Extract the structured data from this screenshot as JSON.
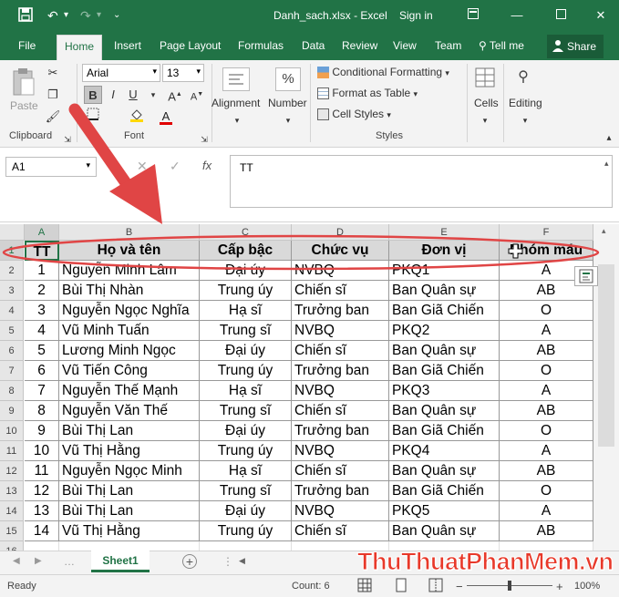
{
  "titlebar": {
    "filename": "Danh_sach.xlsx",
    "sep": "-",
    "app": "Excel",
    "signin": "Sign in",
    "save_icon": "save-icon",
    "undo_icon": "undo-icon",
    "redo_icon": "redo-icon"
  },
  "tabs": [
    "File",
    "Home",
    "Insert",
    "Page Layout",
    "Formulas",
    "Data",
    "Review",
    "View",
    "Team"
  ],
  "tellme": "Tell me",
  "share": "Share",
  "ribbon": {
    "clipboard": {
      "label": "Clipboard",
      "paste": "Paste"
    },
    "font": {
      "label": "Font",
      "name": "Arial",
      "size": "13",
      "bold": "B",
      "italic": "I",
      "underline": "U"
    },
    "alignment": "Alignment",
    "number": {
      "label": "Number",
      "symbol": "%"
    },
    "styles": {
      "label": "Styles",
      "conditional": "Conditional Formatting",
      "table": "Format as Table",
      "cell": "Cell Styles"
    },
    "cells": "Cells",
    "editing": "Editing"
  },
  "formula": {
    "namebox": "A1",
    "fx": "fx",
    "value": "TT"
  },
  "columns": [
    "A",
    "B",
    "C",
    "D",
    "E",
    "F"
  ],
  "header": [
    "TT",
    "Họ và tên",
    "Cấp bậc",
    "Chức vụ",
    "Đơn vị",
    "Nhóm máu"
  ],
  "rows": [
    [
      "1",
      "Nguyễn Minh Lâm",
      "Đại úy",
      "NVBQ",
      "PKQ1",
      "A"
    ],
    [
      "2",
      "Bùi Thị Nhàn",
      "Trung úy",
      "Chiến sĩ",
      "Ban Quân sự",
      "AB"
    ],
    [
      "3",
      "Nguyễn Ngọc Nghĩa",
      "Hạ sĩ",
      "Trưởng ban",
      "Ban Giã Chiến",
      "O"
    ],
    [
      "4",
      "Vũ Minh Tuấn",
      "Trung sĩ",
      "NVBQ",
      "PKQ2",
      "A"
    ],
    [
      "5",
      "Lương Minh Ngọc",
      "Đại úy",
      "Chiến sĩ",
      "Ban Quân sự",
      "AB"
    ],
    [
      "6",
      "Vũ Tiến Công",
      "Trung úy",
      "Trưởng ban",
      "Ban Giã Chiến",
      "O"
    ],
    [
      "7",
      "Nguyễn Thế Mạnh",
      "Hạ sĩ",
      "NVBQ",
      "PKQ3",
      "A"
    ],
    [
      "8",
      "Nguyễn Văn Thế",
      "Trung sĩ",
      "Chiến sĩ",
      "Ban Quân sự",
      "AB"
    ],
    [
      "9",
      "Bùi Thị Lan",
      "Đại úy",
      "Trưởng ban",
      "Ban Giã Chiến",
      "O"
    ],
    [
      "10",
      "Vũ Thị Hằng",
      "Trung úy",
      "NVBQ",
      "PKQ4",
      "A"
    ],
    [
      "11",
      "Nguyễn Ngọc Minh",
      "Hạ sĩ",
      "Chiến sĩ",
      "Ban Quân sự",
      "AB"
    ],
    [
      "12",
      "Bùi Thị Lan",
      "Trung sĩ",
      "Trưởng ban",
      "Ban Giã Chiến",
      "O"
    ],
    [
      "13",
      "Bùi Thị Lan",
      "Đại úy",
      "NVBQ",
      "PKQ5",
      "A"
    ],
    [
      "14",
      "Vũ Thị Hằng",
      "Trung úy",
      "Chiến sĩ",
      "Ban Quân sự",
      "AB"
    ]
  ],
  "row_numbers": [
    "1",
    "2",
    "3",
    "4",
    "5",
    "6",
    "7",
    "8",
    "9",
    "10",
    "11",
    "12",
    "13",
    "14",
    "15",
    "16"
  ],
  "sheet_tab": "Sheet1",
  "status": {
    "ready": "Ready",
    "count": "Count: 6",
    "zoom": "100%"
  },
  "watermark": "ThuThuatPhanMem.vn",
  "colors": {
    "excel_green": "#217346",
    "annotation_red": "#e04545",
    "header_fill": "#d9d9d9"
  }
}
